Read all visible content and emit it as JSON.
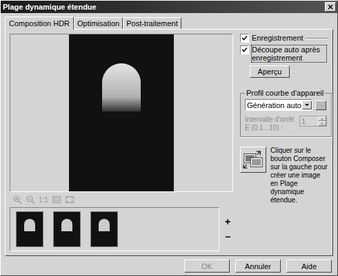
{
  "window": {
    "title": "Plage dynamique étendue",
    "close": "×"
  },
  "tabs": [
    {
      "label": "Composition HDR",
      "selected": true
    },
    {
      "label": "Optimisation",
      "selected": false
    },
    {
      "label": "Post-traitement",
      "selected": false
    }
  ],
  "zoom_tools": {
    "actual_size": "1:1"
  },
  "thumbnails": [
    {
      "selected": false
    },
    {
      "selected": false
    },
    {
      "selected": false
    }
  ],
  "thumbnail_controls": [
    "+",
    "−"
  ],
  "options": [
    {
      "label": "Enregistrement",
      "checked": true,
      "focused": false
    },
    {
      "label": "Découpe auto après enregistrement",
      "checked": true,
      "focused": true
    }
  ],
  "preview_button": "Aperçu",
  "profile": {
    "title": "Profil courbe d'appareil",
    "dropdown": "Génération auto",
    "interval_label": "Intervalle d'arrêt E (0.1...10) :",
    "interval_value": "1",
    "interval_disabled": true
  },
  "compose": {
    "hint": "Cliquer sur le bouton Composer sur la gauche pour créer une image en Plage dynamique étendue."
  },
  "buttons": [
    {
      "label": "OK",
      "disabled": true
    },
    {
      "label": "Annuler",
      "disabled": false
    },
    {
      "label": "Aide",
      "disabled": false
    }
  ]
}
